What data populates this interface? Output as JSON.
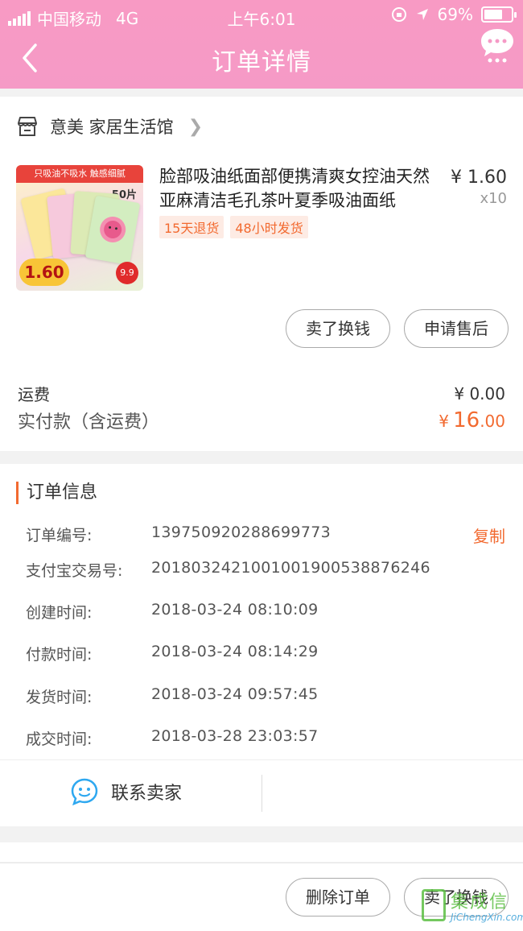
{
  "status_bar": {
    "carrier": "中国移动",
    "network": "4G",
    "time": "上午6:01",
    "battery": "69%",
    "battery_level": 0.69
  },
  "header": {
    "title": "订单详情"
  },
  "shop": {
    "name": "意美 家居生活馆"
  },
  "product": {
    "title": "脸部吸油纸面部便携清爽女控油天然亚麻清洁毛孔茶叶夏季吸油面纸",
    "price": "¥ 1.60",
    "quantity": "x10",
    "tags": [
      "15天退货",
      "48小时发货"
    ],
    "image_text": {
      "banner": "只吸油不吸水  触感细腻",
      "count": "50片",
      "price": "1.60",
      "promo": "9.9"
    }
  },
  "actions": {
    "sell_label": "卖了换钱",
    "after_sale_label": "申请售后"
  },
  "fees": {
    "shipping_label": "运费",
    "shipping_value": "¥ 0.00",
    "total_label": "实付款（含运费）",
    "total_currency": "¥",
    "total_int": "16",
    "total_dec": ".00"
  },
  "order_info": {
    "section_title": "订单信息",
    "rows": [
      {
        "label": "订单编号:",
        "value": "139750920288699773",
        "action": "复制"
      },
      {
        "label": "支付宝交易号:",
        "value": "2018032421001001900538876246"
      },
      {
        "label": "创建时间:",
        "value": "2018-03-24 08:10:09"
      },
      {
        "label": "付款时间:",
        "value": "2018-03-24 08:14:29"
      },
      {
        "label": "发货时间:",
        "value": "2018-03-24 09:57:45"
      },
      {
        "label": "成交时间:",
        "value": "2018-03-28 23:03:57"
      }
    ],
    "contact_label": "联系卖家"
  },
  "bottom": {
    "delete_label": "删除订单",
    "sell_label": "卖了换钱"
  },
  "watermark": {
    "main": "集成信",
    "sub": "JiChengXin.com"
  },
  "colors": {
    "header": "#f89ac4",
    "accent": "#f26a30",
    "tag_bg": "#fdebe4"
  }
}
